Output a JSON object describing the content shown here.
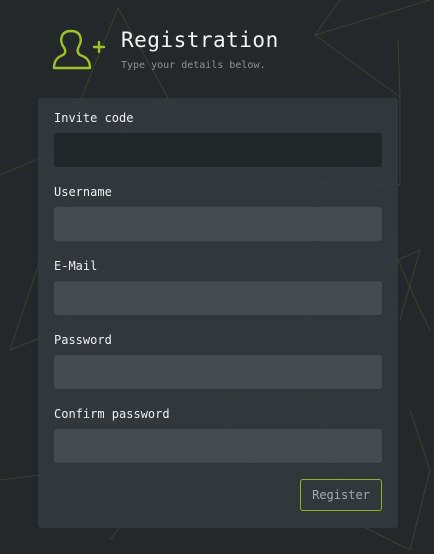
{
  "header": {
    "icon": "add-user-icon",
    "title": "Registration",
    "subtitle": "Type your details below."
  },
  "form": {
    "fields": [
      {
        "label": "Invite code",
        "value": "",
        "placeholder": ""
      },
      {
        "label": "Username",
        "value": "",
        "placeholder": ""
      },
      {
        "label": "E-Mail",
        "value": "",
        "placeholder": ""
      },
      {
        "label": "Password",
        "value": "",
        "placeholder": ""
      },
      {
        "label": "Confirm password",
        "value": "",
        "placeholder": ""
      }
    ],
    "submit_label": "Register"
  },
  "colors": {
    "accent": "#8db32a",
    "background": "#24282b",
    "panel": "#343a3f",
    "input": "#434a50",
    "input_focused": "#22272a"
  }
}
